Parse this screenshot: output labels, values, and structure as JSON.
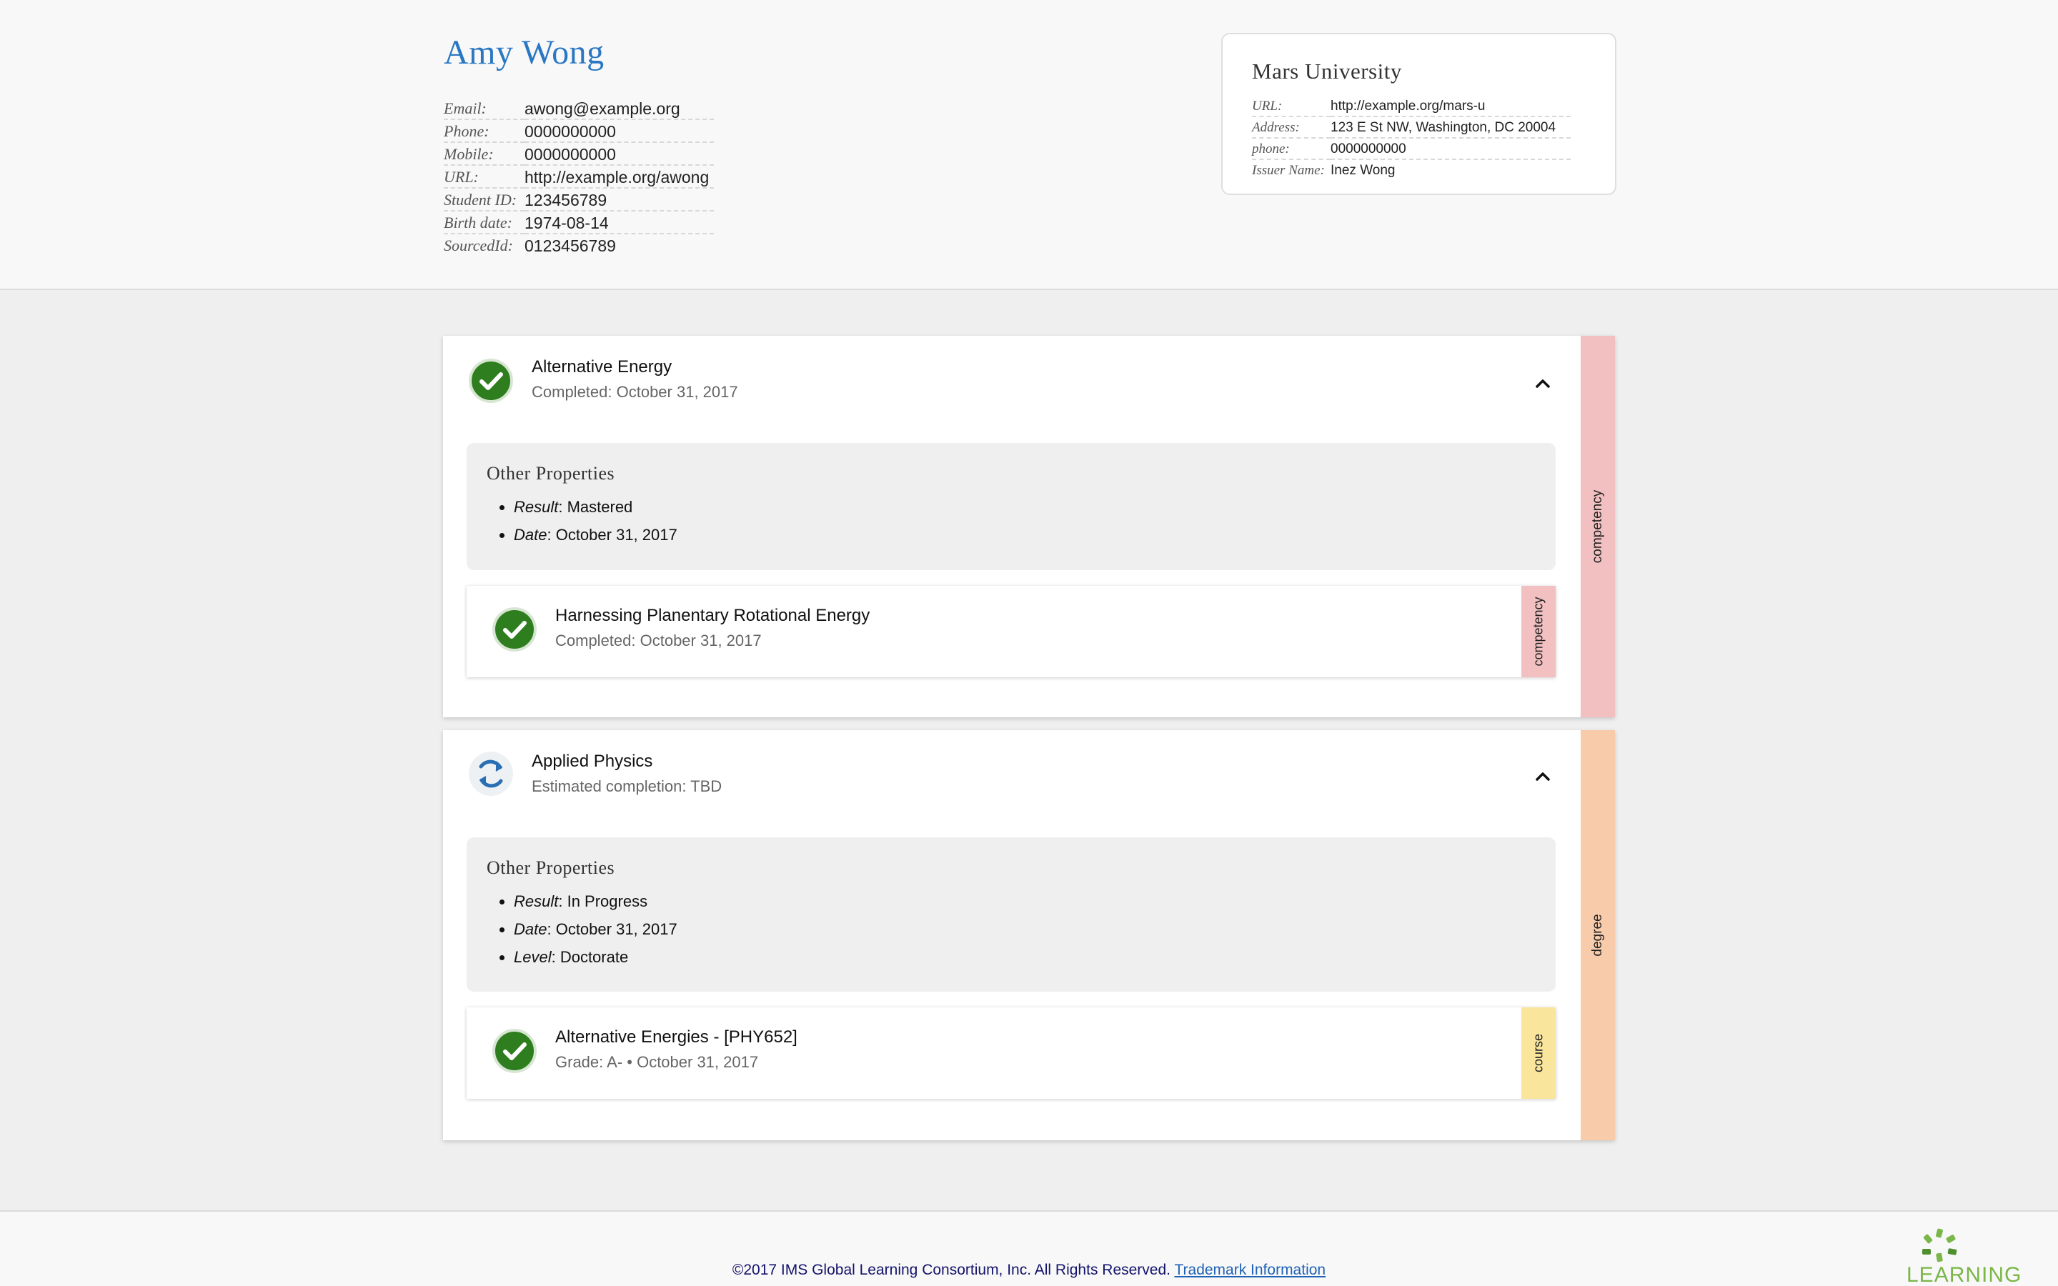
{
  "student": {
    "name": "Amy Wong",
    "fields": [
      {
        "label": "Email:",
        "value": "awong@example.org"
      },
      {
        "label": "Phone:",
        "value": "0000000000"
      },
      {
        "label": "Mobile:",
        "value": "0000000000"
      },
      {
        "label": "URL:",
        "value": "http://example.org/awong"
      },
      {
        "label": "Student ID:",
        "value": "123456789"
      },
      {
        "label": "Birth date:",
        "value": "1974-08-14"
      },
      {
        "label": "SourcedId:",
        "value": "0123456789"
      }
    ]
  },
  "issuer": {
    "name": "Mars University",
    "fields": [
      {
        "label": "URL:",
        "value": "http://example.org/mars-u"
      },
      {
        "label": "Address:",
        "value": "123 E St NW, Washington, DC 20004"
      },
      {
        "label": "phone:",
        "value": "0000000000"
      },
      {
        "label": "Issuer Name:",
        "value": "Inez Wong"
      }
    ]
  },
  "achievements": [
    {
      "title": "Alternative Energy",
      "subtitle": "Completed: October 31, 2017",
      "status_icon": "check-circle-icon",
      "type": "competency",
      "type_color": "#f2c0c1",
      "props_title": "Other Properties",
      "props": [
        {
          "key": "Result",
          "value": ": Mastered"
        },
        {
          "key": "Date",
          "value": ": October 31, 2017"
        }
      ],
      "child": {
        "title": "Harnessing Planentary Rotational Energy",
        "subtitle": "Completed: October 31, 2017",
        "status_icon": "check-circle-icon",
        "type": "competency",
        "type_color": "#f2c0c1"
      }
    },
    {
      "title": "Applied Physics",
      "subtitle": "Estimated completion: TBD",
      "status_icon": "sync-icon",
      "type": "degree",
      "type_color": "#f8cbab",
      "props_title": "Other Properties",
      "props": [
        {
          "key": "Result",
          "value": ": In Progress"
        },
        {
          "key": "Date",
          "value": ": October 31, 2017"
        },
        {
          "key": "Level",
          "value": ": Doctorate"
        }
      ],
      "child": {
        "title": "Alternative Energies - [PHY652]",
        "subtitle": "Grade: A- • October 31, 2017",
        "status_icon": "check-circle-icon",
        "type": "course",
        "type_color": "#f9e59c"
      }
    }
  ],
  "colors": {
    "name_blue": "#2a78c3",
    "success_green": "#2e7d1e",
    "progress_blue": "#2a6fb3"
  },
  "footer": {
    "copyright": "©2017 IMS Global Learning Consortium, Inc. All Rights Reserved.",
    "trademark_link": "Trademark Information",
    "logo_text": "LEARNING"
  }
}
